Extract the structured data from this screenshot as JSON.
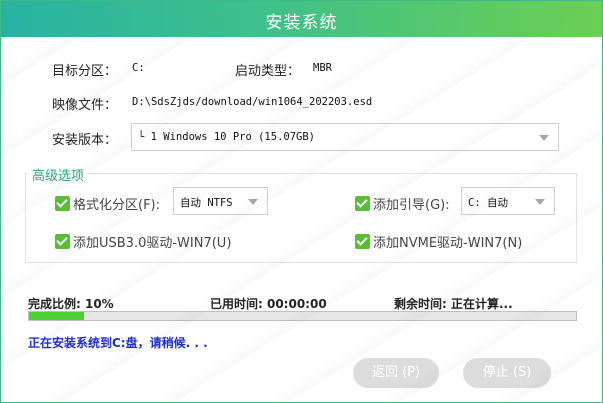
{
  "window": {
    "title": "安装系统"
  },
  "fields": {
    "target_partition_label": "目标分区：",
    "target_partition_value": "C:",
    "boot_type_label": "启动类型：",
    "boot_type_value": "MBR",
    "image_file_label": "映像文件：",
    "image_file_value": "D:\\SdsZjds/download/win1064_202203.esd",
    "install_version_label": "安装版本：",
    "install_version_value": "└ 1 Windows 10 Pro (15.07GB)"
  },
  "advanced": {
    "title": "高级选项",
    "format_label": "格式化分区(F):",
    "format_value": "自动 NTFS",
    "boot_label": "添加引导(G):",
    "boot_value": "C: 自动",
    "usb_label": "添加USB3.0驱动-WIN7(U)",
    "nvme_label": "添加NVME驱动-WIN7(N)"
  },
  "progress": {
    "ratio_label": "完成比例: 10%",
    "ratio": 0.1,
    "elapsed_label": "已用时间: 00:00:00",
    "remaining_label": "剩余时间: 正在计算..."
  },
  "status_text": "正在安装系统到C:盘，请稍候. . .",
  "buttons": {
    "back": "返回 (P)",
    "stop": "停止 (S)"
  },
  "colors": {
    "title_gradient_start": "#27b3a3",
    "title_gradient_end": "#6ccf52",
    "check_green": "#59be36",
    "progress_fill": "#4ccf31",
    "status_blue": "#1f2fd1",
    "section_title": "#27a574"
  }
}
